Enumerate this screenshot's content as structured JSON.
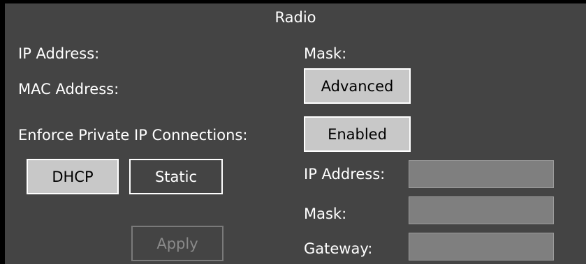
{
  "section": {
    "title": "Radio"
  },
  "info": {
    "ip_address_label": "IP Address:",
    "mask_label": "Mask:",
    "mac_address_label": "MAC Address:",
    "advanced_button": "Advanced"
  },
  "enforce": {
    "label": "Enforce Private IP Connections:",
    "toggle_value": "Enabled"
  },
  "mode": {
    "dhcp_label": "DHCP",
    "static_label": "Static",
    "selected": "DHCP"
  },
  "static_config": {
    "ip_address_label": "IP Address:",
    "ip_address_value": "",
    "mask_label": "Mask:",
    "mask_value": "",
    "gateway_label": "Gateway:",
    "gateway_value": ""
  },
  "actions": {
    "apply_label": "Apply",
    "apply_enabled": false
  }
}
